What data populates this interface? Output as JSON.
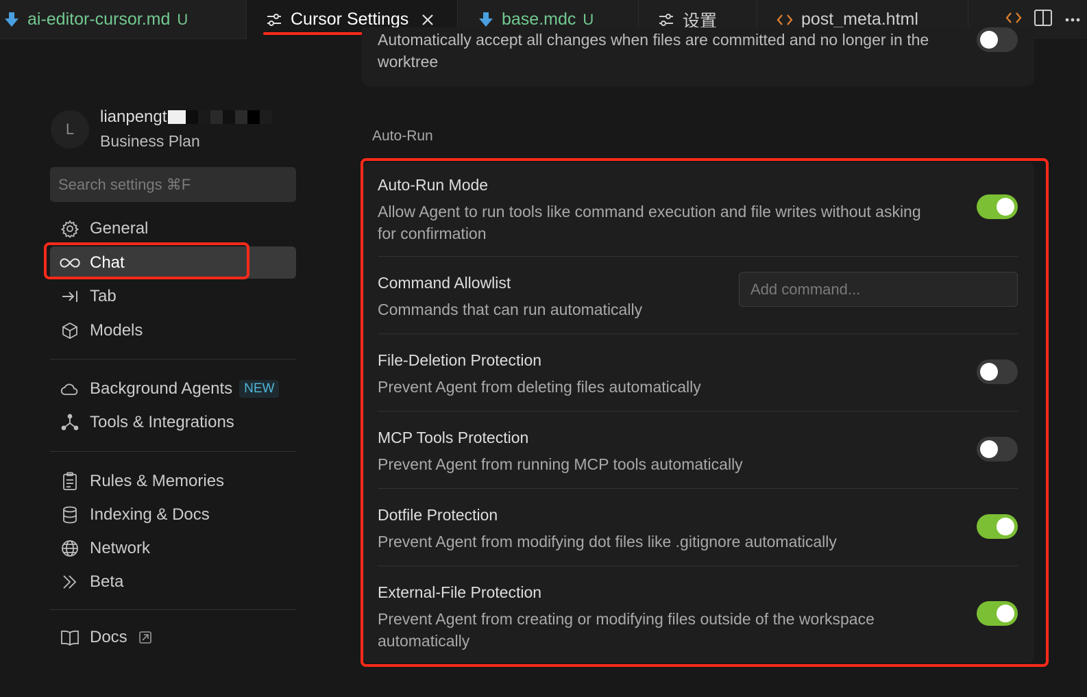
{
  "tabs": [
    {
      "label": "ai-editor-cursor.md",
      "icon": "download-arrow-icon",
      "badge": "U",
      "modified": true,
      "active": false
    },
    {
      "label": "Cursor Settings",
      "icon": "sliders-icon",
      "active": true,
      "closable": true
    },
    {
      "label": "base.mdc",
      "icon": "download-arrow-icon",
      "badge": "U",
      "modified": true,
      "active": false
    },
    {
      "label": "设置",
      "icon": "sliders-icon",
      "active": false
    },
    {
      "label": "post_meta.html",
      "icon": "code-brackets-icon",
      "active": false
    }
  ],
  "profile": {
    "initial": "L",
    "name": "lianpengt",
    "plan": "Business Plan"
  },
  "search": {
    "placeholder": "Search settings ⌘F"
  },
  "nav": {
    "general": "General",
    "chat": "Chat",
    "tab": "Tab",
    "models": "Models",
    "background_agents": "Background Agents",
    "new_badge": "NEW",
    "tools": "Tools & Integrations",
    "rules": "Rules & Memories",
    "indexing": "Indexing & Docs",
    "network": "Network",
    "beta": "Beta",
    "docs": "Docs"
  },
  "top_card": {
    "text": "Automatically accept all changes when files are committed and no longer in the worktree",
    "toggle_on": false
  },
  "section": {
    "label": "Auto-Run"
  },
  "settings": [
    {
      "title": "Auto-Run Mode",
      "desc": "Allow Agent to run tools like command execution and file writes without asking for confirmation",
      "on": true
    },
    {
      "title": "Command Allowlist",
      "desc": "Commands that can run automatically",
      "input_placeholder": "Add command..."
    },
    {
      "title": "File-Deletion Protection",
      "desc": "Prevent Agent from deleting files automatically",
      "on": false
    },
    {
      "title": "MCP Tools Protection",
      "desc": "Prevent Agent from running MCP tools automatically",
      "on": false
    },
    {
      "title": "Dotfile Protection",
      "desc": "Prevent Agent from modifying dot files like .gitignore automatically",
      "on": true
    },
    {
      "title": "External-File Protection",
      "desc": "Prevent Agent from creating or modifying files outside of the workspace automatically",
      "on": true
    }
  ],
  "colors": {
    "toggle_on": "#7bbf34",
    "toggle_off": "#3a3a3a",
    "annotation_red": "#ff2a1a",
    "git_untracked": "#73c991",
    "new_badge": "#4fb6d8"
  }
}
